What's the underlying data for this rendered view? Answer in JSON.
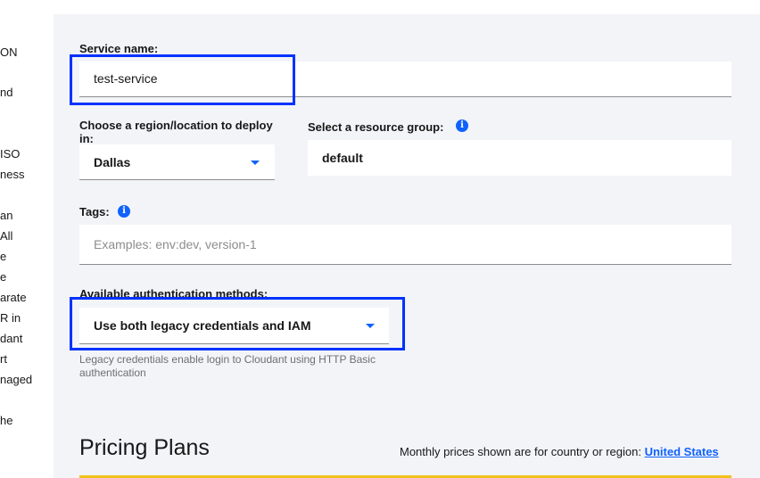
{
  "left_fragments": [
    "ON",
    "nd",
    "ISO",
    "ness",
    "an",
    "All",
    "e",
    "e",
    "arate",
    "R in",
    "dant",
    "rt",
    "naged",
    "he"
  ],
  "form": {
    "service_name_label": "Service name:",
    "service_name_value": "test-service",
    "region_label": "Choose a region/location to deploy in:",
    "region_value": "Dallas",
    "resource_group_label": "Select a resource group:",
    "resource_group_value": "default",
    "tags_label": "Tags:",
    "tags_placeholder": "Examples: env:dev, version-1",
    "auth_label": "Available authentication methods:",
    "auth_value": "Use both legacy credentials and IAM",
    "auth_helper": "Legacy credentials enable login to Cloudant using HTTP Basic authentication"
  },
  "pricing": {
    "title": "Pricing Plans",
    "note": "Monthly prices shown are for country or region:",
    "region_link": "United States"
  },
  "icons": {
    "info": "info-icon",
    "dropdown": "chevron-down-icon"
  },
  "colors": {
    "accent": "#0f62fe",
    "highlight": "#0032ff",
    "panel_bg": "#f2f4f8",
    "plan_bar": "#f1c21b"
  }
}
